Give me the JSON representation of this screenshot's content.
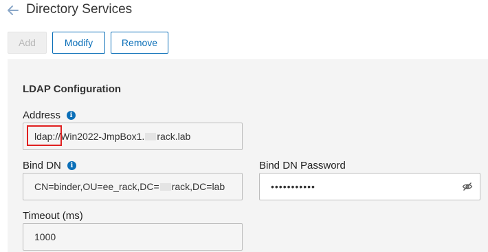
{
  "header": {
    "title": "Directory Services",
    "back_icon": "arrow-left-icon"
  },
  "toolbar": {
    "add_label": "Add",
    "modify_label": "Modify",
    "remove_label": "Remove"
  },
  "ldap": {
    "section_title": "LDAP Configuration",
    "address_label": "Address",
    "address_value_prefix": "ldap://Win2022-JmpBox1.",
    "address_value_suffix": "rack.lab",
    "bind_dn_label": "Bind DN",
    "bind_dn_value_prefix": "CN=binder,OU=ee_rack,DC=",
    "bind_dn_value_suffix": "rack,DC=lab",
    "bind_dn_password_label": "Bind DN Password",
    "bind_dn_password_value": "•••••••••••",
    "timeout_label": "Timeout (ms)",
    "timeout_value": "1000"
  },
  "colors": {
    "accent": "#0b6fb8",
    "highlight": "#e02020",
    "panel_bg": "#f4f4f4"
  }
}
